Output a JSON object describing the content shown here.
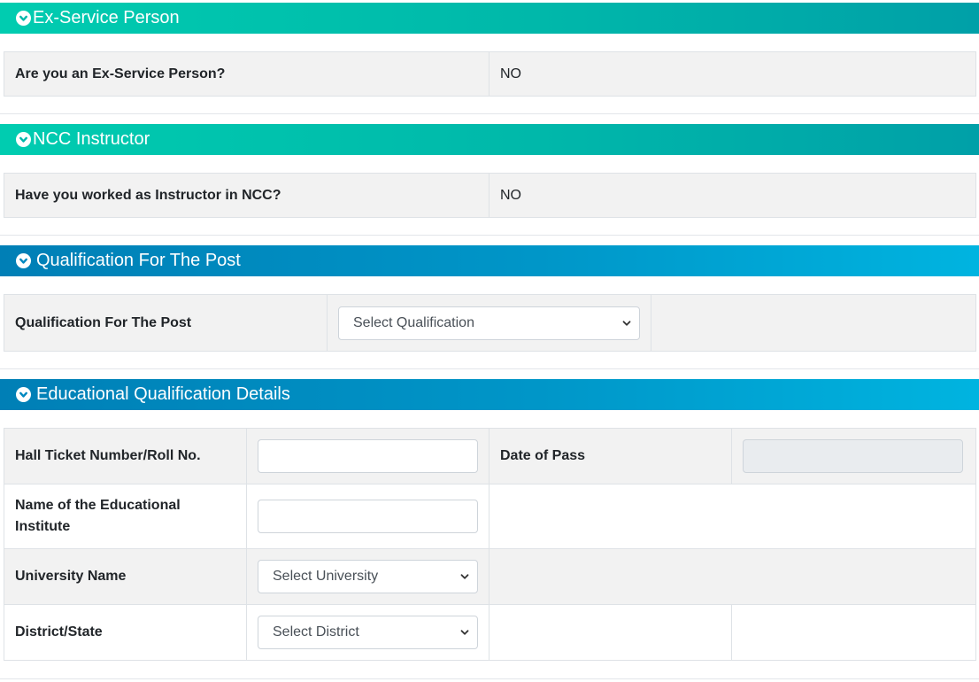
{
  "ex_service": {
    "header": "Ex-Service Person",
    "question": "Are you an Ex-Service Person?",
    "answer": "NO"
  },
  "ncc": {
    "header": "NCC Instructor",
    "question": "Have you worked as Instructor in NCC?",
    "answer": "NO"
  },
  "qualification_post": {
    "header": "Qualification For The Post",
    "label": "Qualification For The Post",
    "select_value": "Select Qualification"
  },
  "educational": {
    "header": "Educational Qualification Details",
    "hall_ticket_label": "Hall Ticket Number/Roll No.",
    "hall_ticket_value": "",
    "date_of_pass_label": "Date of Pass",
    "date_of_pass_value": "",
    "institute_label": "Name of the Educational Institute",
    "institute_value": "",
    "university_label": "University Name",
    "university_select": "Select University",
    "district_label": "District/State",
    "district_select": "Select District"
  },
  "colors": {
    "teal_header": "#00b8aa",
    "blue_header": "#0096c8",
    "row_gray": "#f2f2f2",
    "disabled_input": "#e9ecef"
  },
  "icons": {
    "section_toggle": "chevron-circle-down-icon",
    "select_caret": "chevron-down-icon"
  }
}
